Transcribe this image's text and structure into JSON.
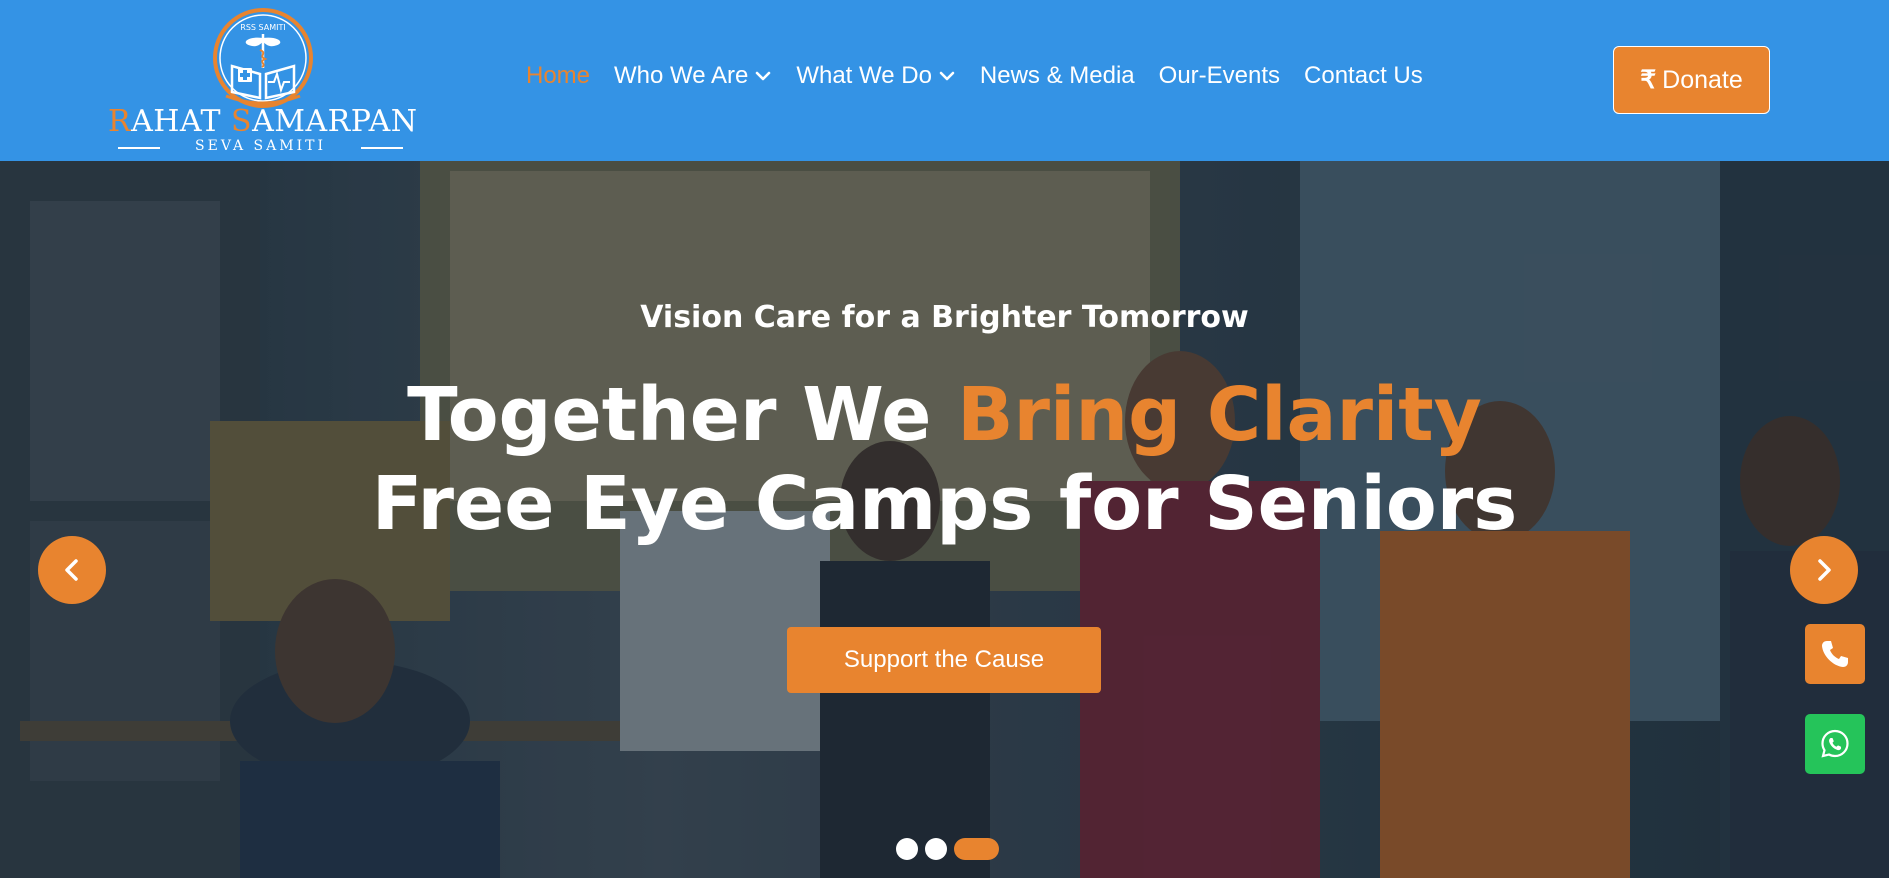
{
  "brand": {
    "emblem_text": "RSS SAMITI",
    "name_first_initial": "R",
    "name_first_rest": "AHAT ",
    "name_second_initial": "S",
    "name_second_rest": "AMARPAN",
    "subtitle": "SEVA SAMITI"
  },
  "nav": {
    "items": [
      {
        "label": "Home",
        "active": true,
        "has_dropdown": false
      },
      {
        "label": "Who We Are",
        "active": false,
        "has_dropdown": true
      },
      {
        "label": "What We Do",
        "active": false,
        "has_dropdown": true
      },
      {
        "label": "News & Media",
        "active": false,
        "has_dropdown": false
      },
      {
        "label": "Our-Events",
        "active": false,
        "has_dropdown": false
      },
      {
        "label": "Contact Us",
        "active": false,
        "has_dropdown": false
      }
    ]
  },
  "donate": {
    "symbol": "₹",
    "label": "Donate"
  },
  "hero": {
    "subtitle": "Vision Care for a Brighter Tomorrow",
    "title_line1_plain": "Together We ",
    "title_line1_accent": "Bring Clarity",
    "title_line2": "Free Eye Camps for Seniors",
    "cta_label": "Support the Cause",
    "slides_total": 3,
    "active_slide": 3
  },
  "colors": {
    "header_bg": "#3493e5",
    "accent": "#e8842f",
    "whatsapp": "#25c45a"
  },
  "icons": {
    "prev": "chevron-left-icon",
    "next": "chevron-right-icon",
    "phone": "phone-icon",
    "whatsapp": "whatsapp-icon",
    "dropdown": "chevron-down-icon"
  }
}
